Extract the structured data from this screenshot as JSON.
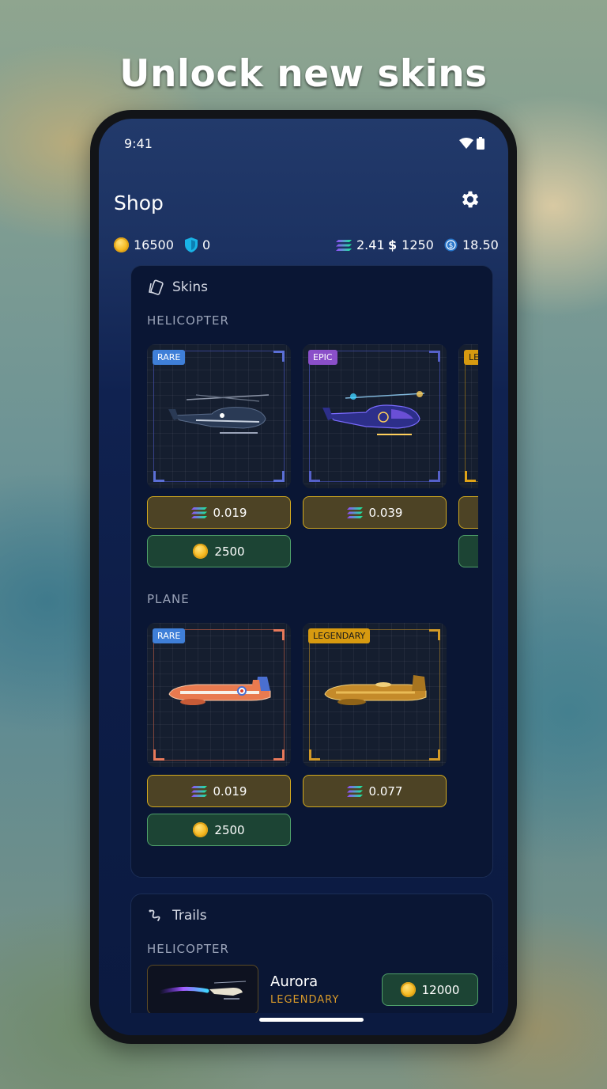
{
  "headline": "Unlock new skins",
  "status": {
    "time": "9:41"
  },
  "appbar": {
    "title": "Shop",
    "settings_icon": "gear-icon"
  },
  "balances": {
    "coins": "16500",
    "shields": "0",
    "sol": "2.41",
    "dollar": "1250",
    "usdc": "18.50"
  },
  "skins": {
    "title": "Skins",
    "helicopter_label": "HELICOPTER",
    "plane_label": "PLANE",
    "helicopter_items": [
      {
        "rarity": "RARE",
        "sol_price": "0.019",
        "coin_price": "2500",
        "accent": "#5b6fd6"
      },
      {
        "rarity": "EPIC",
        "sol_price": "0.039",
        "coin_price": "",
        "accent": "#5560c9"
      },
      {
        "rarity": "LE",
        "sol_price": "",
        "coin_price": "",
        "accent": "#e0a317"
      }
    ],
    "plane_items": [
      {
        "rarity": "RARE",
        "sol_price": "0.019",
        "coin_price": "2500",
        "accent": "#e8795a"
      },
      {
        "rarity": "LEGENDARY",
        "sol_price": "0.077",
        "coin_price": "",
        "accent": "#d39a27"
      }
    ]
  },
  "trails": {
    "title": "Trails",
    "helicopter_label": "HELICOPTER",
    "item": {
      "name": "Aurora",
      "rarity": "LEGENDARY",
      "price": "12000"
    }
  },
  "colors": {
    "rare_badge": "#3f7fd8",
    "epic_badge": "#8a4fc9",
    "legendary_badge": "#d79a10",
    "legendary_text": "#d89a2a"
  }
}
